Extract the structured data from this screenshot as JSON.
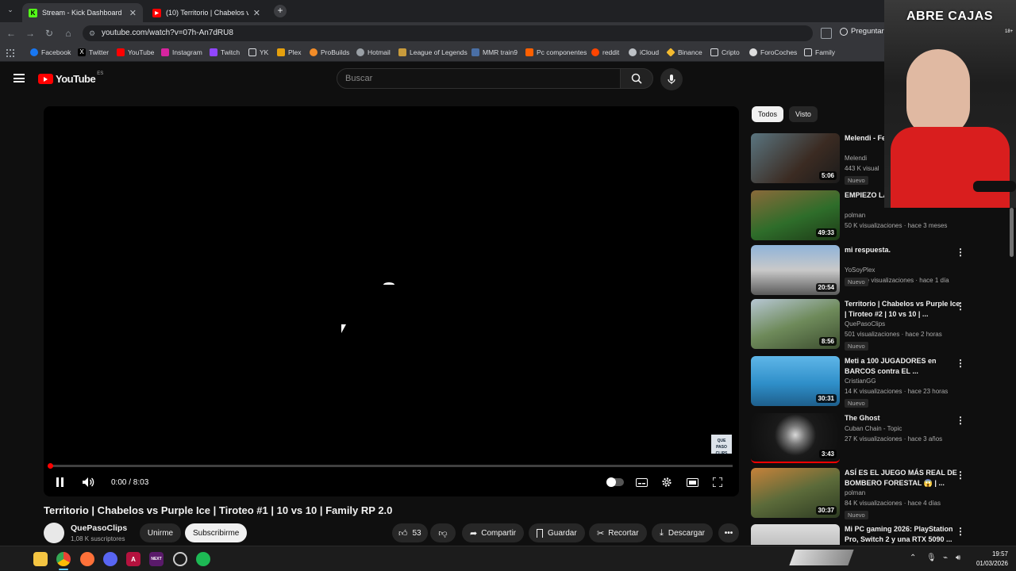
{
  "browser": {
    "tabs": [
      {
        "label": "Stream - Kick Dashboard",
        "icon": "kick-icon",
        "active": true
      },
      {
        "label": "(10) Territorio | Chabelos vs Pur",
        "icon": "youtube-icon",
        "active": false
      }
    ],
    "url": "youtube.com/watch?v=07h-An7dRU8",
    "ask_label": "Preguntar",
    "bookmarks": [
      "Facebook",
      "Twitter",
      "YouTube",
      "Instagram",
      "Twitch",
      "YK",
      "Plex",
      "ProBuilds",
      "Hotmail",
      "League of Legends",
      "MMR train9",
      "Pc componentes",
      "reddit",
      "iCloud",
      "Binance",
      "Cripto",
      "ForoCoches",
      "Family"
    ]
  },
  "youtube": {
    "logo": "YouTube",
    "region": "ES",
    "search_placeholder": "Buscar",
    "accent": "#ff0000"
  },
  "player": {
    "time": "0:00 / 8:03",
    "progress": 0.0,
    "watermark": "QUE PASO CLIPS"
  },
  "video": {
    "title": "Territorio | Chabelos vs Purple Ice | Tiroteo #1 | 10 vs 10 | Family RP 2.0",
    "channel": "QuePasoClips",
    "subscribers": "1,08 K suscriptores",
    "join": "Unirme",
    "subscribe": "Subscribirme",
    "likes": "53",
    "share": "Compartir",
    "save": "Guardar",
    "clip": "Recortar",
    "download": "Descargar"
  },
  "sidebar": {
    "chips": [
      "Todos",
      "Visto"
    ],
    "recs": [
      {
        "title": "Melendi - Fe (Video Ofici",
        "channel": "Melendi",
        "meta": "443 K visual",
        "badge": "Nuevo",
        "duration": "5:06"
      },
      {
        "title": "EMPIEZO LA PIENSO en I",
        "channel": "polman",
        "meta": "50 K visualizaciones · hace 3 meses",
        "badge": "",
        "duration": "49:33"
      },
      {
        "title": "mi respuesta.",
        "channel": "YoSoyPlex",
        "meta": "1,4 M de visualizaciones · hace 1 día",
        "badge": "Nuevo",
        "duration": "20:54"
      },
      {
        "title": "Territorio | Chabelos vs Purple Ice | Tiroteo #2 | 10 vs 10 | ...",
        "channel": "QuePasoClips",
        "meta": "501 visualizaciones · hace 2 horas",
        "badge": "Nuevo",
        "duration": "8:56"
      },
      {
        "title": "Meti a 100 JUGADORES en BARCOS contra EL ...",
        "channel": "CristianGG",
        "meta": "14 K visualizaciones · hace 23 horas",
        "badge": "Nuevo",
        "duration": "30:31"
      },
      {
        "title": "The Ghost",
        "channel": "Cuban Chain - Topic",
        "meta": "27 K visualizaciones · hace 3 años",
        "badge": "",
        "duration": "3:43"
      },
      {
        "title": "ASÍ ES EL JUEGO MÁS REAL DE BOMBERO FORESTAL 😱 | ...",
        "channel": "polman",
        "meta": "84 K visualizaciones · hace 4 días",
        "badge": "Nuevo",
        "duration": "30:37"
      },
      {
        "title": "Mi PC gaming 2026: PlayStation Pro, Switch 2 y una RTX 5090 ...",
        "channel": "",
        "meta": "",
        "badge": "",
        "duration": ""
      }
    ]
  },
  "overlay": {
    "stream_text": "ABRE CAJAS",
    "tag": "18+"
  },
  "taskbar": {
    "time": "19:57",
    "date": "01/03/2026"
  }
}
